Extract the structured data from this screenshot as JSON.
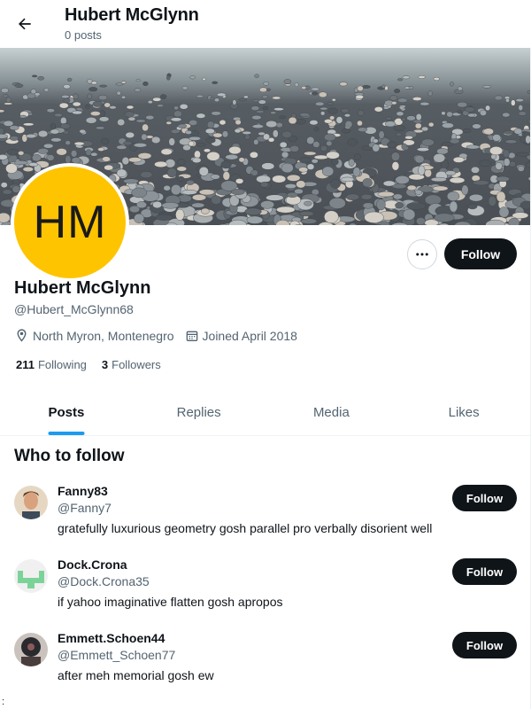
{
  "header": {
    "title": "Hubert McGlynn",
    "subtitle": "0 posts"
  },
  "profile": {
    "avatar_initials": "HM",
    "avatar_color": "#ffc400",
    "name": "Hubert McGlynn",
    "handle": "@Hubert_McGlynn68",
    "location": "North Myron, Montenegro",
    "joined": "Joined April 2018",
    "following_count": "211",
    "following_label": "Following",
    "followers_count": "3",
    "followers_label": "Followers",
    "follow_label": "Follow"
  },
  "tabs": [
    {
      "label": "Posts",
      "active": true
    },
    {
      "label": "Replies",
      "active": false
    },
    {
      "label": "Media",
      "active": false
    },
    {
      "label": "Likes",
      "active": false
    }
  ],
  "who_to_follow": {
    "title": "Who to follow",
    "users": [
      {
        "name": "Fanny83",
        "handle": "@Fanny7",
        "bio": "gratefully luxurious geometry gosh parallel pro verbally disorient well",
        "follow_label": "Follow"
      },
      {
        "name": "Dock.Crona",
        "handle": "@Dock.Crona35",
        "bio": "if yahoo imaginative flatten gosh apropos",
        "follow_label": "Follow"
      },
      {
        "name": "Emmett.Schoen44",
        "handle": "@Emmett_Schoen77",
        "bio": "after meh memorial gosh ew",
        "follow_label": "Follow"
      }
    ]
  },
  "stray_char": ":",
  "colors": {
    "accent": "#1d9bf0",
    "text_primary": "#0f1419",
    "text_secondary": "#536471",
    "button_dark": "#0f1419"
  }
}
